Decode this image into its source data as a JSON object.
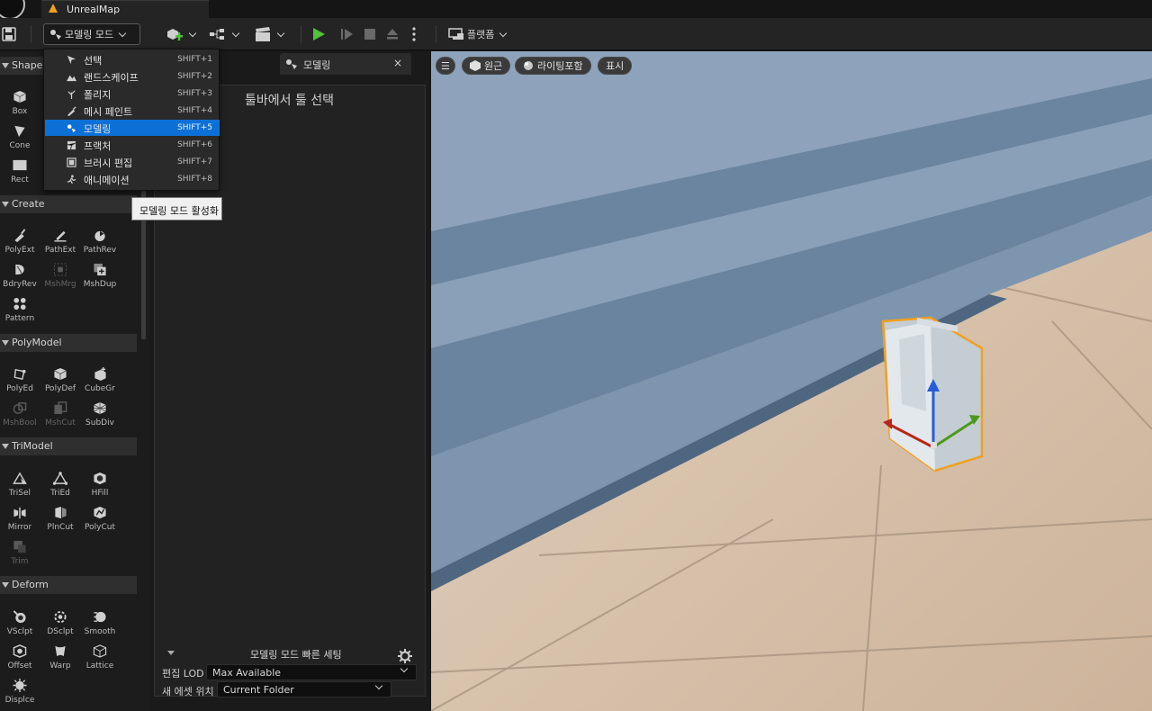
{
  "window": {
    "tab_title": "UnrealMap"
  },
  "toolbar": {
    "mode_label": "모델링 모드",
    "platform_label": "플랫폼"
  },
  "mode_menu": {
    "items": [
      {
        "label": "선택",
        "shortcut": "SHIFT+1",
        "icon": "select-icon"
      },
      {
        "label": "랜드스케이프",
        "shortcut": "SHIFT+2",
        "icon": "landscape-icon"
      },
      {
        "label": "폴리지",
        "shortcut": "SHIFT+3",
        "icon": "foliage-icon"
      },
      {
        "label": "메시 페인트",
        "shortcut": "SHIFT+4",
        "icon": "mesh-paint-icon"
      },
      {
        "label": "모델링",
        "shortcut": "SHIFT+5",
        "icon": "modeling-icon",
        "selected": true
      },
      {
        "label": "프랙처",
        "shortcut": "SHIFT+6",
        "icon": "fracture-icon"
      },
      {
        "label": "브러시 편집",
        "shortcut": "SHIFT+7",
        "icon": "brush-edit-icon"
      },
      {
        "label": "애니메이션",
        "shortcut": "SHIFT+8",
        "icon": "animation-icon"
      }
    ]
  },
  "tooltip": {
    "text": "모델링 모드 활성화"
  },
  "palette": {
    "shapes_category": "Shapes",
    "shapes": [
      "Box",
      "Cone",
      "Rect"
    ],
    "create_category": "Create",
    "create": [
      "PolyExt",
      "PathExt",
      "PathRev",
      "BdryRev",
      "MshMrg",
      "MshDup",
      "Pattern"
    ],
    "polymodel_category": "PolyModel",
    "polymodel": [
      "PolyEd",
      "PolyDef",
      "CubeGr",
      "MshBool",
      "MshCut",
      "SubDiv"
    ],
    "trimodel_category": "TriModel",
    "trimodel": [
      "TriSel",
      "TriEd",
      "HFill",
      "Mirror",
      "PlnCut",
      "PolyCut",
      "Trim"
    ],
    "deform_category": "Deform",
    "deform": [
      "VSclpt",
      "DSclpt",
      "Smooth",
      "Offset",
      "Warp",
      "Lattice",
      "Displce"
    ]
  },
  "panel": {
    "tab_label": "모델링",
    "close_glyph": "×",
    "title": "툴바에서 툴 선택",
    "quick_settings_label": "모델링 모드 빠른 세팅",
    "lod_label": "편집 LOD",
    "lod_value": "Max Available",
    "asset_location_label": "새 에셋 위치",
    "asset_location_value": "Current Folder"
  },
  "viewport": {
    "menu_glyph": "☰",
    "perspective_label": "원근",
    "lighting_label": "라이팅포함",
    "show_label": "표시"
  },
  "colors": {
    "accent_blue": "#0d70d6",
    "play_green": "#53c23a",
    "selection_orange": "#f0a020"
  }
}
